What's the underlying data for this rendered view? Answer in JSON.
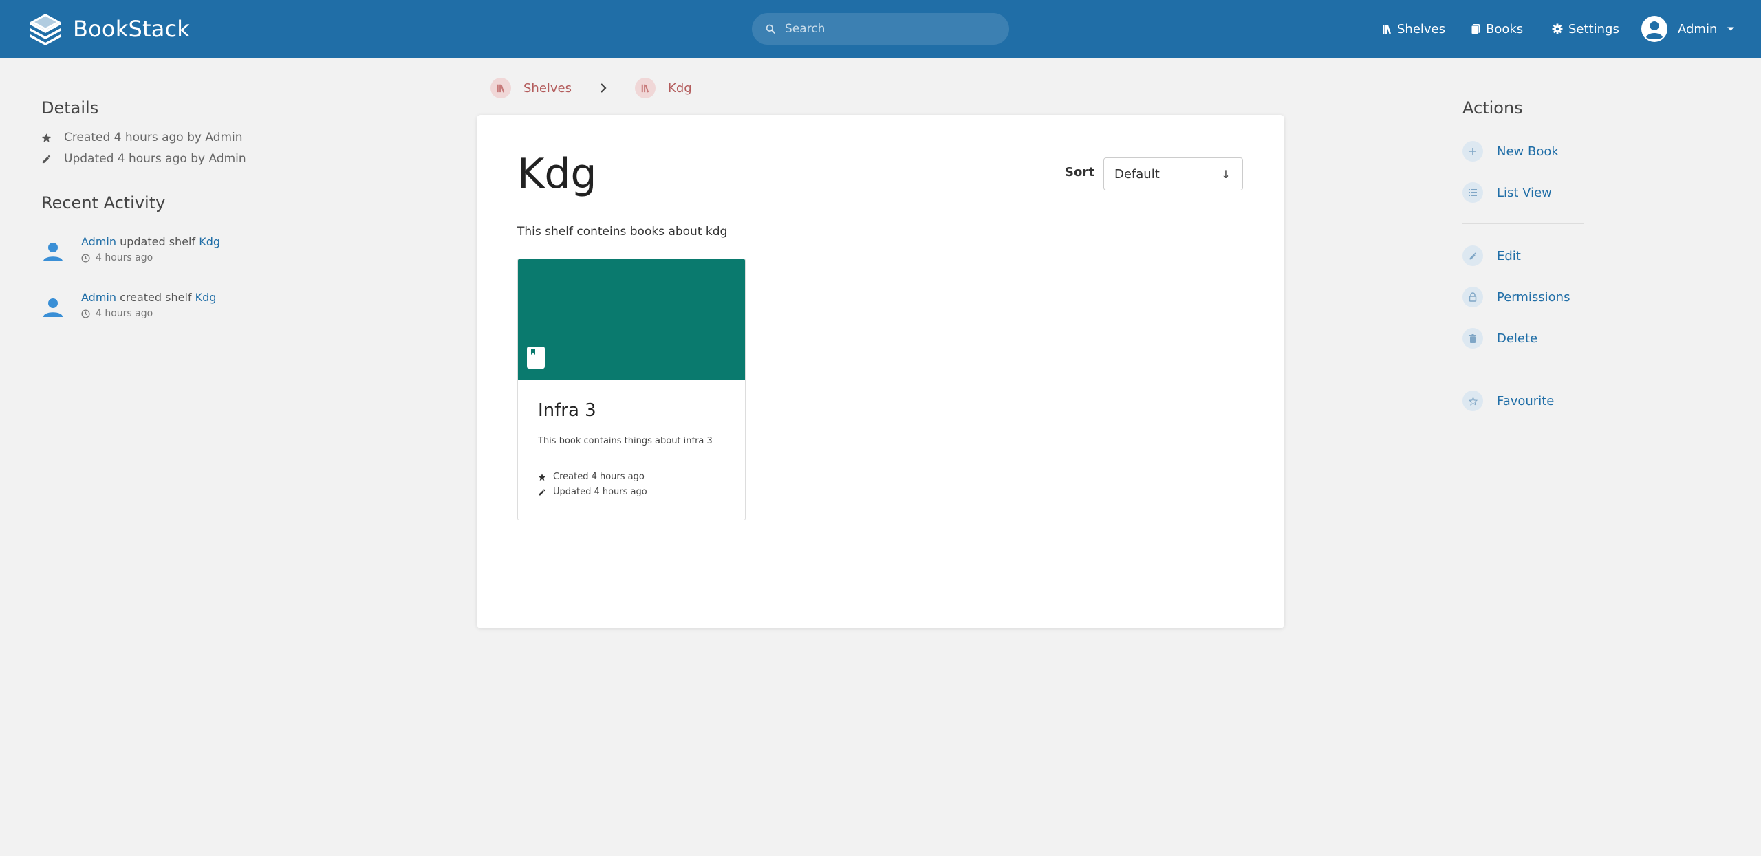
{
  "app": {
    "name": "BookStack"
  },
  "search": {
    "placeholder": "Search"
  },
  "nav": {
    "shelves": "Shelves",
    "books": "Books",
    "settings": "Settings",
    "user": "Admin"
  },
  "breadcrumb": [
    {
      "label": "Shelves",
      "icon": "bookshelf-icon"
    },
    {
      "label": "Kdg",
      "icon": "bookshelf-icon"
    }
  ],
  "details": {
    "title": "Details",
    "created": "Created 4 hours ago by Admin",
    "updated": "Updated 4 hours ago by Admin"
  },
  "recent_activity": {
    "title": "Recent Activity",
    "items": [
      {
        "user": "Admin",
        "action": "updated shelf",
        "target": "Kdg",
        "time": "4 hours ago"
      },
      {
        "user": "Admin",
        "action": "created shelf",
        "target": "Kdg",
        "time": "4 hours ago"
      }
    ]
  },
  "shelf": {
    "title": "Kdg",
    "description": "This shelf conteins books about kdg",
    "sort_label": "Sort",
    "sort_value": "Default",
    "sort_direction": "↓"
  },
  "books": [
    {
      "title": "Infra 3",
      "description": "This book contains things about infra 3",
      "created": "Created 4 hours ago",
      "updated": "Updated 4 hours ago",
      "cover_color": "#0a7a6e"
    }
  ],
  "actions": {
    "title": "Actions",
    "new_book": "New Book",
    "list_view": "List View",
    "edit": "Edit",
    "permissions": "Permissions",
    "delete": "Delete",
    "favourite": "Favourite"
  },
  "colors": {
    "header": "#206ea7",
    "link": "#206ea7",
    "shelf_accent": "#b35c5c",
    "book_cover": "#0a7a6e",
    "background": "#f2f2f2"
  }
}
